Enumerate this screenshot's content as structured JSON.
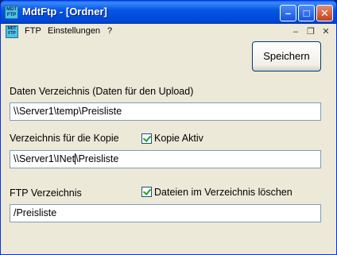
{
  "window": {
    "title": "MdtFtp - [Ordner]",
    "icon_text": "MDT FTP",
    "minimize": "–",
    "maximize": "□",
    "close": "✕"
  },
  "menu": {
    "items": [
      "FTP",
      "Einstellungen",
      "?"
    ],
    "mdi_minimize": "–",
    "mdi_restore": "❐",
    "mdi_close": "✕"
  },
  "form": {
    "save_label": "Speichern",
    "daten_label": "Daten Verzeichnis (Daten für den Upload)",
    "daten_value": "\\\\Server1\\temp\\Preisliste",
    "kopie_label": "Verzeichnis für die Kopie",
    "kopie_checkbox_label": "Kopie Aktiv",
    "kopie_checked": true,
    "kopie_value_before": "\\\\Server1\\INet",
    "kopie_value_after": "\\Preisliste",
    "ftp_label": "FTP Verzeichnis",
    "loeschen_checkbox_label": "Dateien im Verzeichnis löschen",
    "loeschen_checked": true,
    "ftp_value": "/Preisliste"
  }
}
